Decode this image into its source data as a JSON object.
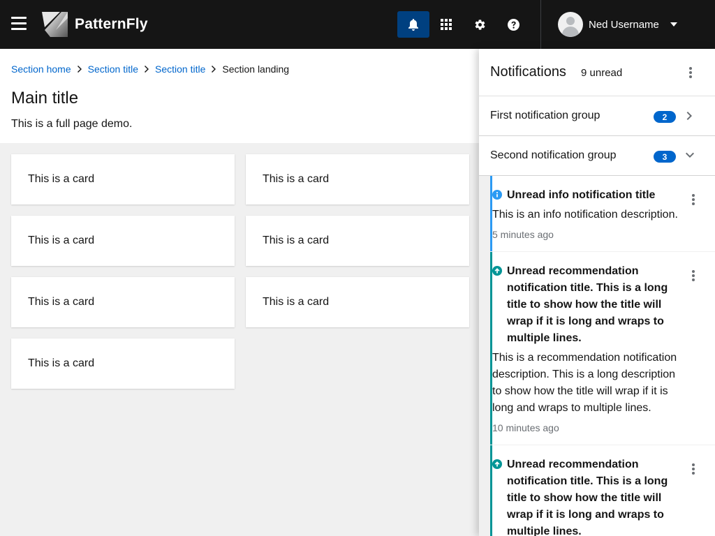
{
  "masthead": {
    "brand": "PatternFly",
    "user_name": "Ned Username",
    "icons": [
      "hamburger-icon",
      "bell-icon",
      "grid-icon",
      "gear-icon",
      "help-icon"
    ]
  },
  "breadcrumb": {
    "items": [
      "Section home",
      "Section title",
      "Section title"
    ],
    "current": "Section landing"
  },
  "page": {
    "title": "Main title",
    "description": "This is a full page demo."
  },
  "cards": [
    "This is a card",
    "This is a card",
    "This is a card",
    "This is a card",
    "This is a card",
    "This is a card",
    "This is a card"
  ],
  "drawer": {
    "title": "Notifications",
    "unread": "9 unread",
    "groups": [
      {
        "title": "First notification group",
        "count": "2",
        "expanded": false
      },
      {
        "title": "Second notification group",
        "count": "3",
        "expanded": true
      }
    ],
    "notifications": [
      {
        "type": "info",
        "title": "Unread info notification title",
        "description": "This is an info notification description.",
        "time": "5 minutes ago"
      },
      {
        "type": "recommendation",
        "title": "Unread recommendation notification title. This is a long title to show how the title will wrap if it is long and wraps to multiple lines.",
        "description": "This is a recommendation notification description. This is a long description to show how the title will wrap if it is long and wraps to multiple lines.",
        "time": "10 minutes ago"
      },
      {
        "type": "recommendation",
        "title": "Unread recommendation notification title. This is a long title to show how the title will wrap if it is long and wraps to multiple lines.",
        "description": "",
        "time": ""
      }
    ]
  },
  "colors": {
    "masthead": "#151515",
    "active_button": "#004080",
    "link": "#06c",
    "info": "#2b9af3",
    "recommendation": "#009596"
  }
}
